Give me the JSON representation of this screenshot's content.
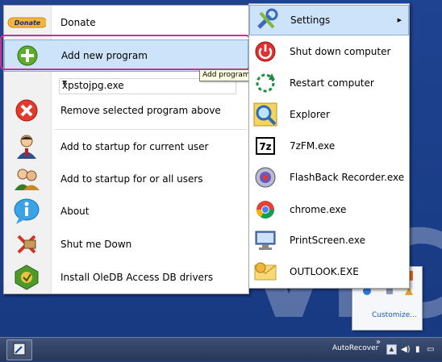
{
  "left_menu": {
    "donate_button": "Donate",
    "items": [
      {
        "label": "Donate"
      },
      {
        "label": "Add new program"
      },
      {
        "label": "Remove selected program above"
      },
      {
        "label": "Add to startup for current user"
      },
      {
        "label": "Add to startup for or all users"
      },
      {
        "label": "About"
      },
      {
        "label": "Shut me Down"
      },
      {
        "label": "Install OleDB Access DB drivers"
      }
    ],
    "combo_value": "xpstojpg.exe",
    "tooltip": "Add programs to your menu"
  },
  "right_menu": {
    "items": [
      {
        "label": "Settings",
        "icon": "settings-tools-icon"
      },
      {
        "label": "Shut down computer",
        "icon": "power-icon"
      },
      {
        "label": "Restart computer",
        "icon": "restart-icon"
      },
      {
        "label": "Explorer",
        "icon": "magnifier-icon"
      },
      {
        "label": "7zFM.exe",
        "icon": "7zip-icon"
      },
      {
        "label": "FlashBack Recorder.exe",
        "icon": "flashback-icon"
      },
      {
        "label": "chrome.exe",
        "icon": "chrome-icon"
      },
      {
        "label": "PrintScreen.exe",
        "icon": "printscreen-icon"
      },
      {
        "label": "OUTLOOK.EXE",
        "icon": "outlook-icon"
      }
    ]
  },
  "tray_popup": {
    "customize": "Customize..."
  },
  "taskbar": {
    "toolbar_label": "AutoRecover",
    "chevron": "»"
  },
  "colors": {
    "highlight": "#cde3fa",
    "focus_ring": "#c8328c",
    "desktop": "#1f4391"
  }
}
